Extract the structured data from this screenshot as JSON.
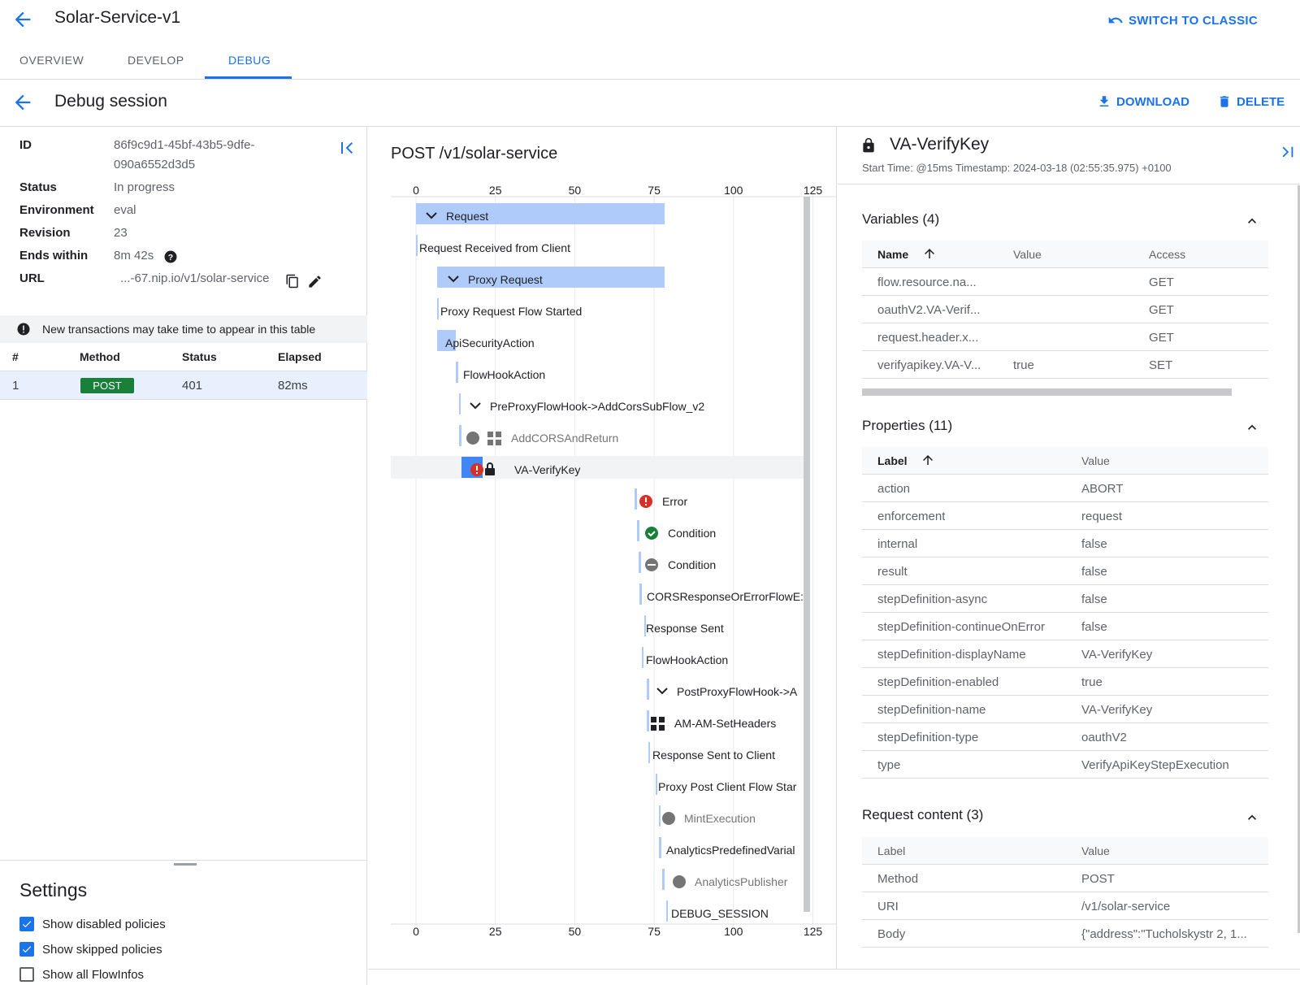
{
  "header": {
    "title": "Solar-Service-v1",
    "switch_label": "SWITCH TO CLASSIC",
    "tabs": [
      "OVERVIEW",
      "DEVELOP",
      "DEBUG"
    ]
  },
  "session": {
    "title": "Debug session",
    "download_label": "DOWNLOAD",
    "delete_label": "DELETE"
  },
  "info": {
    "id_label": "ID",
    "id_line1": "86f9c9d1-45bf-43b5-9dfe-",
    "id_line2": "090a6552d3d5",
    "status_label": "Status",
    "status": "In progress",
    "env_label": "Environment",
    "env": "eval",
    "rev_label": "Revision",
    "rev": "23",
    "ends_label": "Ends within",
    "ends": "8m 42s",
    "url_label": "URL",
    "url": "...-67.nip.io/v1/solar-service"
  },
  "notice": "New transactions may take time to appear in this table",
  "transactions": {
    "headers": [
      "#",
      "Method",
      "Status",
      "Elapsed"
    ],
    "row": {
      "num": "1",
      "method": "POST",
      "status": "401",
      "elapsed": "82ms"
    }
  },
  "settings": {
    "title": "Settings",
    "options": [
      {
        "label": "Show disabled policies",
        "checked": true
      },
      {
        "label": "Show skipped policies",
        "checked": true
      },
      {
        "label": "Show all FlowInfos",
        "checked": false
      }
    ]
  },
  "timeline": {
    "title": "POST /v1/solar-service",
    "ticks": [
      "0",
      "25",
      "50",
      "75",
      "100",
      "125"
    ],
    "rows": [
      {
        "label": "Request",
        "indent": 0,
        "kind": "group",
        "icon": "chevron-down-icon"
      },
      {
        "label": "Request Received from Client",
        "indent": 0,
        "kind": "info"
      },
      {
        "label": "Proxy Request",
        "indent": 1,
        "kind": "group",
        "icon": "chevron-down-icon"
      },
      {
        "label": "Proxy Request Flow Started",
        "indent": 1,
        "kind": "info"
      },
      {
        "label": "ApiSecurityAction",
        "indent": 1,
        "kind": "bar"
      },
      {
        "label": "FlowHookAction",
        "indent": 2,
        "kind": "info"
      },
      {
        "label": "PreProxyFlowHook->AddCorsSubFlow_v2",
        "indent": 2,
        "kind": "sub",
        "icon": "chevron-down-icon"
      },
      {
        "label": "AddCORSAndReturn",
        "indent": 2,
        "kind": "skipped",
        "icon": "grid-icon"
      },
      {
        "label": "VA-VerifyKey",
        "indent": 2,
        "kind": "selected",
        "icon": "lock-icon"
      },
      {
        "label": "Error",
        "indent": 3,
        "kind": "error",
        "icon": "error-icon"
      },
      {
        "label": "Condition",
        "indent": 3,
        "kind": "ok",
        "icon": "check-circle-icon"
      },
      {
        "label": "Condition",
        "indent": 3,
        "kind": "minus",
        "icon": "minus-circle-icon"
      },
      {
        "label": "CORSResponseOrErrorFlowE:",
        "indent": 3,
        "kind": "info"
      },
      {
        "label": "Response Sent",
        "indent": 3,
        "kind": "info"
      },
      {
        "label": "FlowHookAction",
        "indent": 3,
        "kind": "info"
      },
      {
        "label": "PostProxyFlowHook->A",
        "indent": 3,
        "kind": "sub",
        "icon": "chevron-down-icon"
      },
      {
        "label": "AM-AM-SetHeaders",
        "indent": 3,
        "kind": "policy",
        "icon": "grid-icon"
      },
      {
        "label": "Response Sent to Client",
        "indent": 3,
        "kind": "info"
      },
      {
        "label": "Proxy Post Client Flow Star",
        "indent": 3,
        "kind": "info"
      },
      {
        "label": "MintExecution",
        "indent": 3,
        "kind": "skipped"
      },
      {
        "label": "AnalyticsPredefinedVarial",
        "indent": 3,
        "kind": "info"
      },
      {
        "label": "AnalyticsPublisher",
        "indent": 3,
        "kind": "skipped"
      },
      {
        "label": "DEBUG_SESSION",
        "indent": 3,
        "kind": "info"
      }
    ]
  },
  "policy": {
    "title": "VA-VerifyKey",
    "start_time": "Start Time: @15ms Timestamp: 2024-03-18 (02:55:35.975) +0100"
  },
  "variables": {
    "title": "Variables (4)",
    "headers": [
      "Name",
      "Value",
      "Access"
    ],
    "rows": [
      [
        "flow.resource.na...",
        "",
        "GET"
      ],
      [
        "oauthV2.VA-Verif...",
        "",
        "GET"
      ],
      [
        "request.header.x...",
        "",
        "GET"
      ],
      [
        "verifyapikey.VA-V...",
        "true",
        "SET"
      ]
    ]
  },
  "properties": {
    "title": "Properties (11)",
    "headers": [
      "Label",
      "Value"
    ],
    "rows": [
      [
        "action",
        "ABORT"
      ],
      [
        "enforcement",
        "request"
      ],
      [
        "internal",
        "false"
      ],
      [
        "result",
        "false"
      ],
      [
        "stepDefinition-async",
        "false"
      ],
      [
        "stepDefinition-continueOnError",
        "false"
      ],
      [
        "stepDefinition-displayName",
        "VA-VerifyKey"
      ],
      [
        "stepDefinition-enabled",
        "true"
      ],
      [
        "stepDefinition-name",
        "VA-VerifyKey"
      ],
      [
        "stepDefinition-type",
        "oauthV2"
      ],
      [
        "type",
        "VerifyApiKeyStepExecution"
      ]
    ]
  },
  "request_content": {
    "title": "Request content (3)",
    "headers": [
      "Label",
      "Value"
    ],
    "rows": [
      [
        "Method",
        "POST"
      ],
      [
        "URI",
        "/v1/solar-service"
      ],
      [
        "Body",
        "{\"address\":\"Tucholskystr 2, 1..."
      ]
    ]
  },
  "colors": {
    "accent": "#1a73e8",
    "bar": "#aecbfa",
    "post": "#188038",
    "error": "#d93025",
    "ok": "#188038"
  }
}
